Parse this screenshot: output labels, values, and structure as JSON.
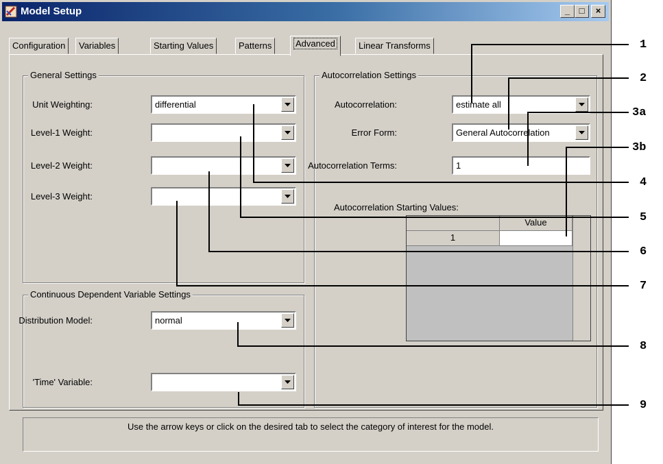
{
  "window": {
    "title": "Model Setup",
    "controls": {
      "minimize": "_",
      "maximize": "□",
      "close": "×"
    }
  },
  "tabs": [
    {
      "label": "Configuration",
      "active": false
    },
    {
      "label": "Variables",
      "active": false
    },
    {
      "label": "Starting Values",
      "active": false
    },
    {
      "label": "Patterns",
      "active": false
    },
    {
      "label": "Advanced",
      "active": true
    },
    {
      "label": "Linear Transforms",
      "active": false
    }
  ],
  "general_settings": {
    "title": "General Settings",
    "unit_weighting": {
      "label": "Unit Weighting:",
      "value": "differential"
    },
    "level1_weight": {
      "label": "Level-1 Weight:",
      "value": ""
    },
    "level2_weight": {
      "label": "Level-2 Weight:",
      "value": ""
    },
    "level3_weight": {
      "label": "Level-3 Weight:",
      "value": ""
    }
  },
  "continuous_settings": {
    "title": "Continuous Dependent Variable Settings",
    "distribution_model": {
      "label": "Distribution Model:",
      "value": "normal"
    },
    "time_variable": {
      "label": "'Time' Variable:",
      "value": ""
    }
  },
  "autocorrelation_settings": {
    "title": "Autocorrelation Settings",
    "autocorrelation": {
      "label": "Autocorrelation:",
      "value": "estimate all"
    },
    "error_form": {
      "label": "Error Form:",
      "value": "General Autocorrelation"
    },
    "terms": {
      "label": "Autocorrelation Terms:",
      "value": "1"
    },
    "starting_values_label": "Autocorrelation Starting Values:",
    "grid": {
      "column_header": "Value",
      "row_header": "1",
      "cell_value": ""
    }
  },
  "status_text": "Use the arrow keys or click on the desired tab to select the category of interest for the model.",
  "callouts": [
    "1",
    "2",
    "3a",
    "3b",
    "4",
    "5",
    "6",
    "7",
    "8",
    "9"
  ],
  "colors": {
    "window_face": "#d4d0c8",
    "title_start": "#0a246a",
    "title_end": "#a6caf0"
  }
}
